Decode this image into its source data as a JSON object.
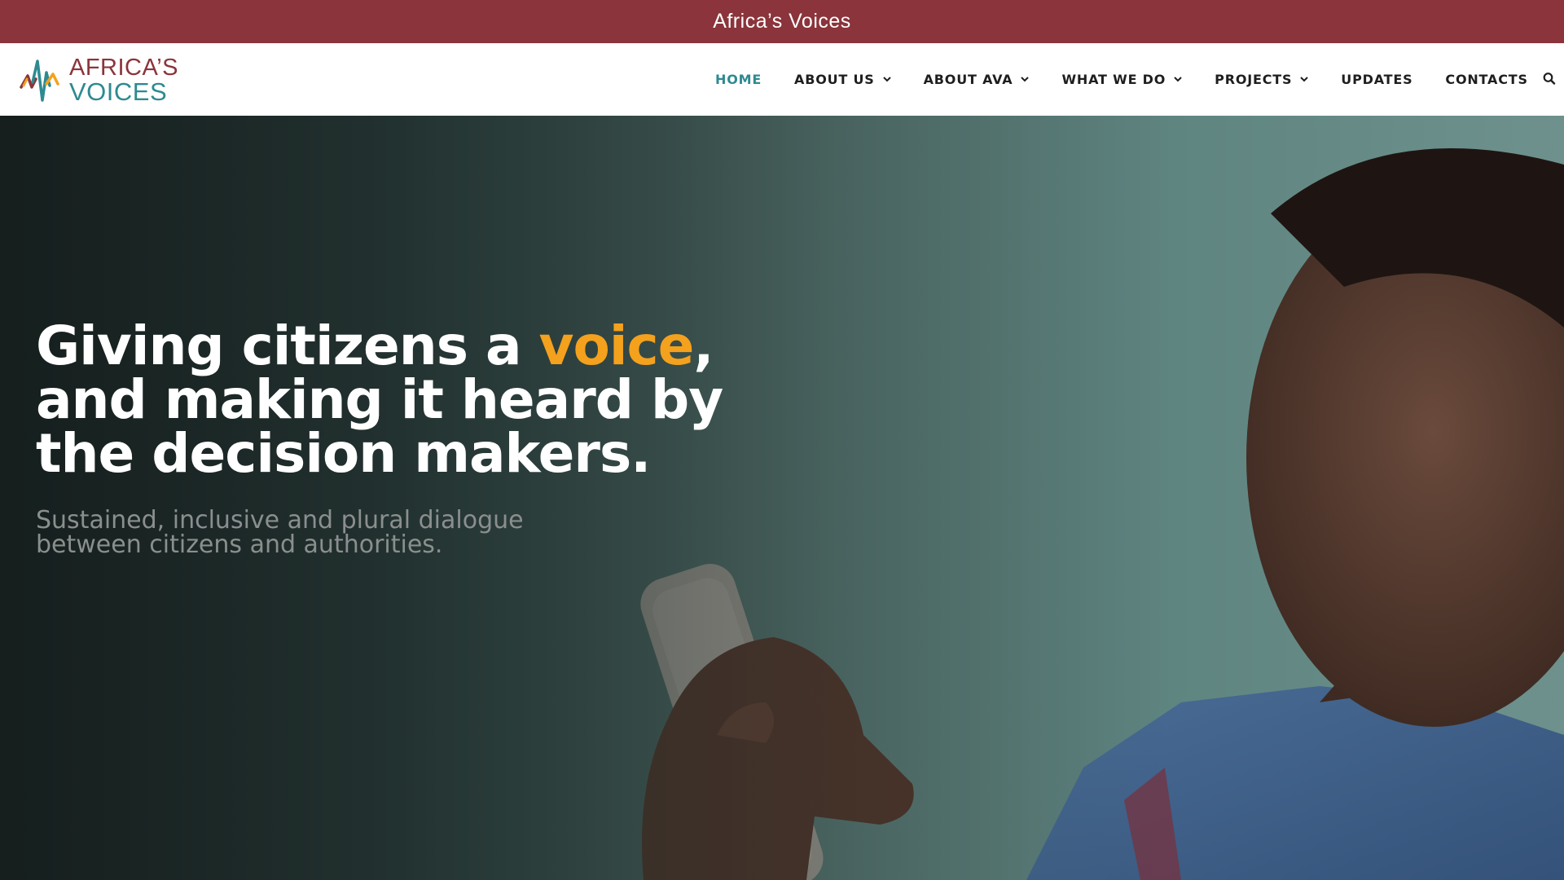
{
  "top_bar": {
    "title": "Africa’s Voices"
  },
  "logo": {
    "line1": "AFRICA’S",
    "line2": "VOICES"
  },
  "nav": {
    "items": [
      {
        "label": "HOME",
        "active": true,
        "dropdown": false
      },
      {
        "label": "ABOUT US",
        "active": false,
        "dropdown": true
      },
      {
        "label": "ABOUT AVA",
        "active": false,
        "dropdown": true
      },
      {
        "label": "WHAT WE DO",
        "active": false,
        "dropdown": true
      },
      {
        "label": "PROJECTS",
        "active": false,
        "dropdown": true
      },
      {
        "label": "UPDATES",
        "active": false,
        "dropdown": false
      },
      {
        "label": "CONTACTS",
        "active": false,
        "dropdown": false
      }
    ],
    "search_icon": "search-icon",
    "dropdown_icon": "chevron-down-icon"
  },
  "hero": {
    "headline": {
      "part1": "Giving citizens a ",
      "highlight": "voice",
      "part2": ", and making it heard by the decision makers."
    },
    "subheading": "Sustained, inclusive and plural dialogue between citizens and authorities.",
    "image": "man-holding-mobile-phone-photo"
  },
  "colors": {
    "brand_red": "#8b343b",
    "brand_teal": "#2e8a91",
    "accent_orange": "#f4a11d",
    "nav_text": "#1e1e1e"
  }
}
